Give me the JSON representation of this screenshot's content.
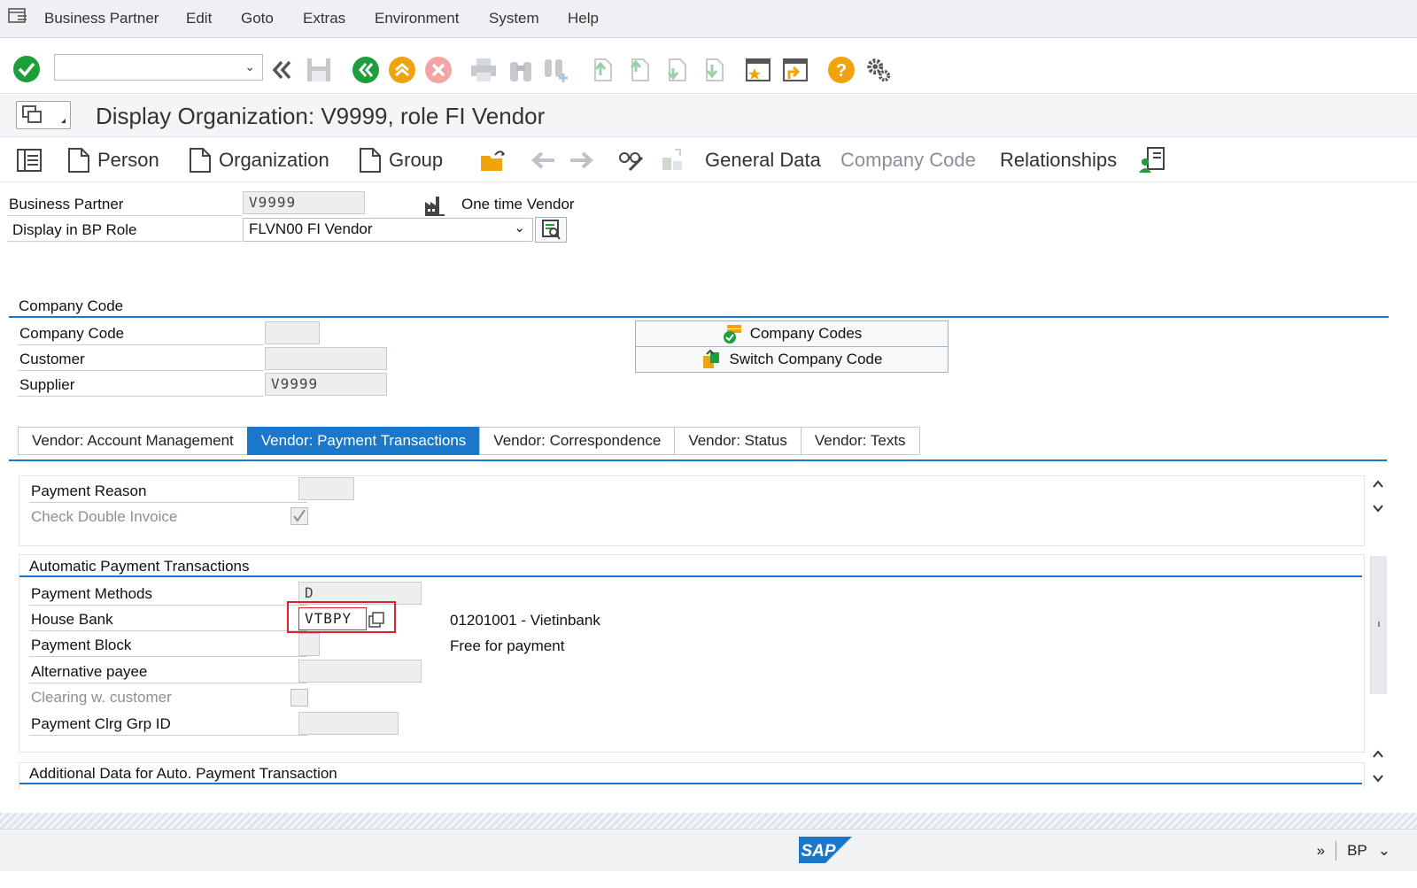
{
  "menu": {
    "items": [
      "Business Partner",
      "Edit",
      "Goto",
      "Extras",
      "Environment",
      "System",
      "Help"
    ]
  },
  "toolbar": {
    "command_field_value": "",
    "icons": [
      "enter-icon",
      "back-double-icon",
      "save-icon",
      "back-icon",
      "exit-icon",
      "cancel-icon",
      "print-icon",
      "find-icon",
      "find-next-icon",
      "first-page-icon",
      "previous-page-icon",
      "next-page-icon",
      "last-page-icon",
      "new-session-icon",
      "shortcut-icon",
      "help-icon",
      "settings-icon"
    ]
  },
  "title": {
    "text": "Display Organization: V9999, role FI Vendor"
  },
  "app_toolbar": {
    "person": "Person",
    "organization": "Organization",
    "group": "Group",
    "general_data": "General Data",
    "company_code": "Company Code",
    "relationships": "Relationships"
  },
  "header": {
    "bp_label": "Business Partner",
    "bp_value": "V9999",
    "bp_desc": "One time Vendor",
    "role_label": "Display in BP Role",
    "role_value": "FLVN00 FI Vendor"
  },
  "company_code_section": {
    "title": "Company Code",
    "company_code_label": "Company Code",
    "company_code_value": "",
    "customer_label": "Customer",
    "customer_value": "",
    "supplier_label": "Supplier",
    "supplier_value": "V9999",
    "company_codes_button": "Company Codes",
    "switch_button": "Switch Company Code"
  },
  "tabs": [
    {
      "label": "Vendor: Account Management",
      "active": false
    },
    {
      "label": "Vendor: Payment Transactions",
      "active": true
    },
    {
      "label": "Vendor: Correspondence",
      "active": false
    },
    {
      "label": "Vendor: Status",
      "active": false
    },
    {
      "label": "Vendor: Texts",
      "active": false
    }
  ],
  "payment": {
    "payment_reason_label": "Payment Reason",
    "payment_reason_value": "",
    "check_double_label": "Check Double Invoice",
    "check_double_checked": true
  },
  "auto_payment": {
    "title": "Automatic Payment Transactions",
    "methods_label": "Payment Methods",
    "methods_value": "D",
    "house_bank_label": "House Bank",
    "house_bank_value": "VTBPY",
    "house_bank_desc": "01201001 - Vietinbank",
    "block_label": "Payment Block",
    "block_value": "",
    "block_desc": "Free for payment",
    "alt_payee_label": "Alternative payee",
    "alt_payee_value": "",
    "clearing_label": "Clearing w. customer",
    "clearing_checked": false,
    "clrg_grp_label": "Payment Clrg Grp ID",
    "clrg_grp_value": ""
  },
  "additional": {
    "title": "Additional Data for Auto. Payment Transaction"
  },
  "status": {
    "transaction": "BP",
    "logo": "SAP"
  },
  "colors": {
    "accent": "#1a77c9",
    "highlight": "#d9232d",
    "enter_green": "#1e9e3a",
    "nav_orange": "#f0a30a",
    "cancel_red": "#e0454b"
  }
}
